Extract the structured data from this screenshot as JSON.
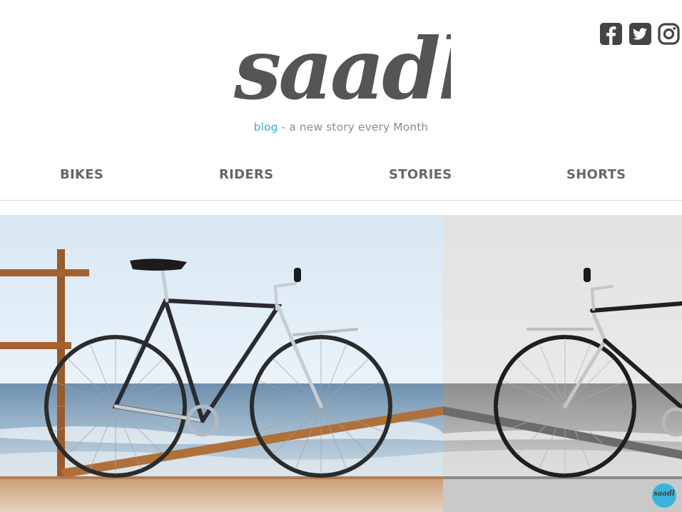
{
  "header": {
    "logo_text": "saadl",
    "tagline_accent": "blog",
    "tagline_rest": " - a new story every Month"
  },
  "social": {
    "icons": [
      "facebook-icon",
      "twitter-icon",
      "instagram-icon"
    ],
    "color": "#444444"
  },
  "nav": {
    "items": [
      {
        "label": "BIKES"
      },
      {
        "label": "RIDERS"
      },
      {
        "label": "STORIES"
      },
      {
        "label": "SHORTS"
      }
    ]
  },
  "hero": {
    "description": "",
    "badge_text": "saadl"
  },
  "colors": {
    "accent": "#35aed6",
    "logo": "#555555",
    "nav": "#666666"
  }
}
